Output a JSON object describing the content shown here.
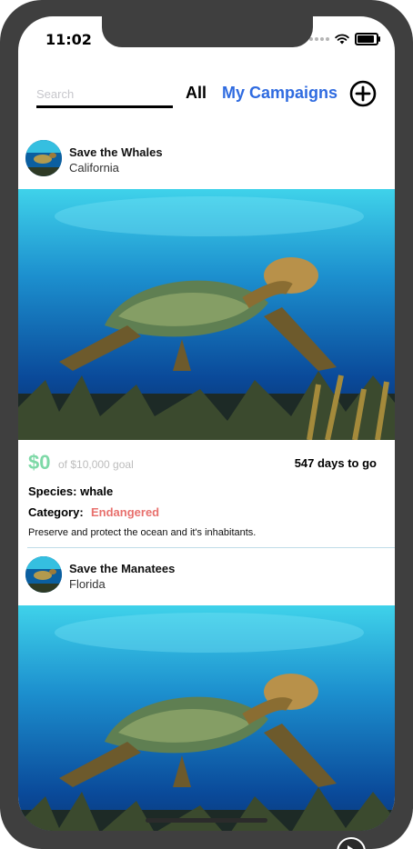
{
  "status": {
    "time": "11:02"
  },
  "topbar": {
    "search_placeholder": "Search",
    "search_value": "",
    "tabs": [
      {
        "label": "All",
        "active": false
      },
      {
        "label": "My Campaigns",
        "active": true
      }
    ],
    "add_icon": "plus-circle-icon"
  },
  "campaigns": [
    {
      "title": "Save the Whales",
      "location": "California",
      "image": "sea-turtle-photo",
      "amount": "$0",
      "goal": "of $10,000 goal",
      "days_left": "547 days to go",
      "species": "Species: whale",
      "category_label": "Category:",
      "category_value": "Endangered",
      "description": "Preserve and protect the ocean and it's inhabitants."
    },
    {
      "title": "Save the Manatees",
      "location": "Florida",
      "image": "sea-turtle-photo"
    }
  ],
  "colors": {
    "accent": "#2f6be0",
    "amount": "#7ed9a7",
    "category": "#e8706d",
    "goal_text": "#bdbdbd",
    "frame": "#3f3f3f"
  }
}
